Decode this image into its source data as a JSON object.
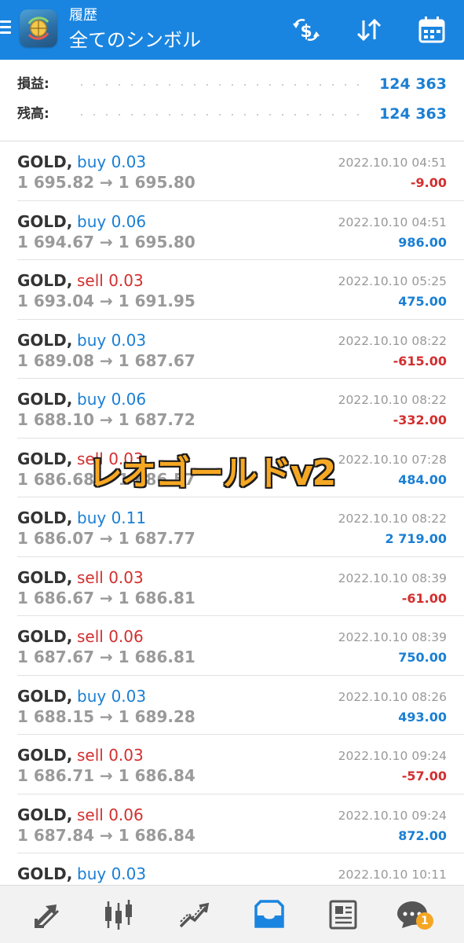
{
  "header": {
    "subtitle": "履歴",
    "title": "全てのシンボル",
    "bg_color": "#1a85e0"
  },
  "summary": {
    "profit_label": "損益:",
    "profit_value": "124 363",
    "balance_label": "残高:",
    "balance_value": "124 363"
  },
  "deals": [
    {
      "symbol": "GOLD,",
      "type": "buy 0.03",
      "side": "buy",
      "prices": "1 695.82 → 1 695.80",
      "time": "2022.10.10 04:51",
      "profit": "-9.00"
    },
    {
      "symbol": "GOLD,",
      "type": "buy 0.06",
      "side": "buy",
      "prices": "1 694.67 → 1 695.80",
      "time": "2022.10.10 04:51",
      "profit": "986.00"
    },
    {
      "symbol": "GOLD,",
      "type": "sell 0.03",
      "side": "sell",
      "prices": "1 693.04 → 1 691.95",
      "time": "2022.10.10 05:25",
      "profit": "475.00"
    },
    {
      "symbol": "GOLD,",
      "type": "buy 0.03",
      "side": "buy",
      "prices": "1 689.08 → 1 687.67",
      "time": "2022.10.10 08:22",
      "profit": "-615.00"
    },
    {
      "symbol": "GOLD,",
      "type": "buy 0.06",
      "side": "buy",
      "prices": "1 688.10 → 1 687.72",
      "time": "2022.10.10 08:22",
      "profit": "-332.00"
    },
    {
      "symbol": "GOLD,",
      "type": "sell 0.03",
      "side": "sell",
      "prices": "1 686.68 → 1 686.57",
      "time": "2022.10.10 07:28",
      "profit": "484.00"
    },
    {
      "symbol": "GOLD,",
      "type": "buy 0.11",
      "side": "buy",
      "prices": "1 686.07 → 1 687.77",
      "time": "2022.10.10 08:22",
      "profit": "2 719.00"
    },
    {
      "symbol": "GOLD,",
      "type": "sell 0.03",
      "side": "sell",
      "prices": "1 686.67 → 1 686.81",
      "time": "2022.10.10 08:39",
      "profit": "-61.00"
    },
    {
      "symbol": "GOLD,",
      "type": "sell 0.06",
      "side": "sell",
      "prices": "1 687.67 → 1 686.81",
      "time": "2022.10.10 08:39",
      "profit": "750.00"
    },
    {
      "symbol": "GOLD,",
      "type": "buy 0.03",
      "side": "buy",
      "prices": "1 688.15 → 1 689.28",
      "time": "2022.10.10 08:26",
      "profit": "493.00"
    },
    {
      "symbol": "GOLD,",
      "type": "sell 0.03",
      "side": "sell",
      "prices": "1 686.71 → 1 686.84",
      "time": "2022.10.10 09:24",
      "profit": "-57.00"
    },
    {
      "symbol": "GOLD,",
      "type": "sell 0.06",
      "side": "sell",
      "prices": "1 687.84 → 1 686.84",
      "time": "2022.10.10 09:24",
      "profit": "872.00"
    },
    {
      "symbol": "GOLD,",
      "type": "buy 0.03",
      "side": "buy",
      "prices": "",
      "time": "2022.10.10 10:11",
      "profit": ""
    }
  ],
  "watermark": "レオゴールドv2",
  "nav": {
    "items": [
      {
        "icon": "quotes-icon"
      },
      {
        "icon": "chart-icon"
      },
      {
        "icon": "trade-icon"
      },
      {
        "icon": "history-icon",
        "active": true
      },
      {
        "icon": "news-icon"
      },
      {
        "icon": "messages-icon"
      }
    ],
    "messages_badge": "1",
    "active_color": "#1a85e0",
    "inactive_color": "#555555"
  }
}
